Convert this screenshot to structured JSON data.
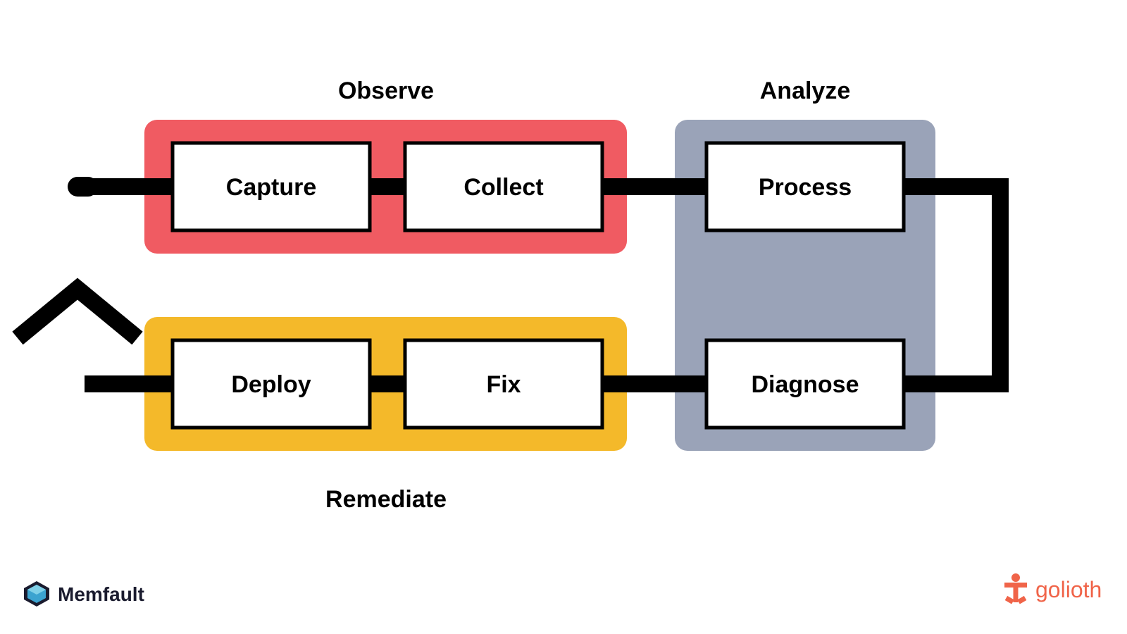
{
  "phases": {
    "observe": {
      "label": "Observe",
      "color": "#f05b62"
    },
    "analyze": {
      "label": "Analyze",
      "color": "#9aa3b8"
    },
    "remediate": {
      "label": "Remediate",
      "color": "#f4b92a"
    }
  },
  "boxes": {
    "capture": {
      "label": "Capture"
    },
    "collect": {
      "label": "Collect"
    },
    "process": {
      "label": "Process"
    },
    "diagnose": {
      "label": "Diagnose"
    },
    "fix": {
      "label": "Fix"
    },
    "deploy": {
      "label": "Deploy"
    }
  },
  "logos": {
    "memfault": {
      "name": "Memfault",
      "color": "#3ba3d0"
    },
    "golioth": {
      "name": "golioth",
      "color": "#f06449"
    }
  },
  "colors": {
    "line": "#000000",
    "boxFill": "#ffffff",
    "boxStroke": "#000000"
  }
}
